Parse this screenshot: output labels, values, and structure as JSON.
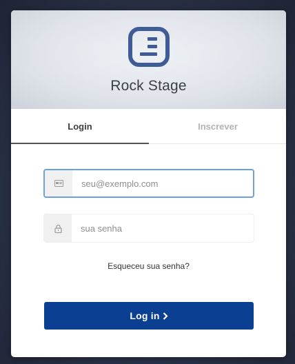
{
  "app": {
    "name": "Rock Stage"
  },
  "tabs": [
    {
      "label": "Login",
      "active": true
    },
    {
      "label": "Inscrever",
      "active": false
    }
  ],
  "form": {
    "email_placeholder": "seu@exemplo.com",
    "email_value": "",
    "password_placeholder": "sua senha",
    "password_value": "",
    "forgot_label": "Esqueceu sua senha?",
    "submit_label": "Log in"
  },
  "icons": {
    "logo": "rock-stage-logo",
    "email": "id-card-icon",
    "password": "lock-icon",
    "submit": "chevron-right-icon"
  },
  "colors": {
    "accent": "#0b3f91",
    "logo": "#3f5c96",
    "focus_border": "#6aa0dc"
  }
}
